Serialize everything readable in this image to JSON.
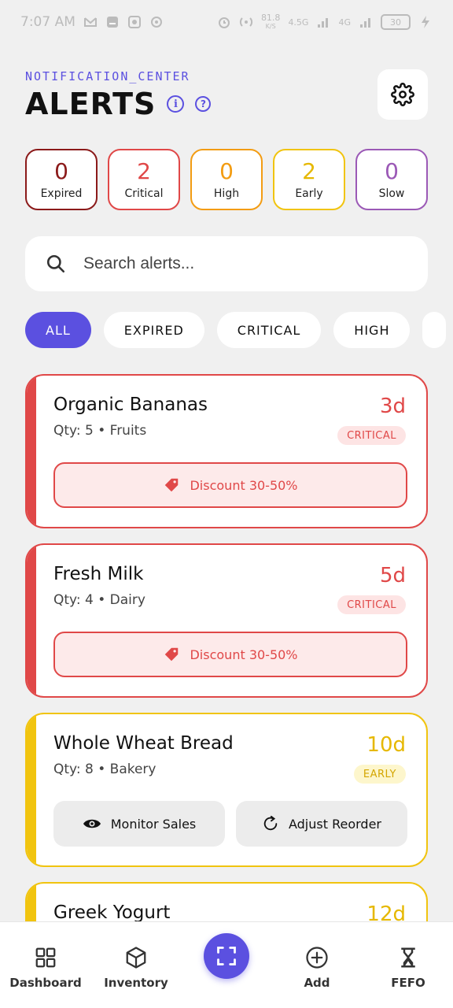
{
  "status_bar": {
    "time": "7:07 AM",
    "net_speed": "81.8",
    "net_unit": "K/S",
    "net_type": "4.5G",
    "net_type2": "4G",
    "battery": "30"
  },
  "header": {
    "subtitle": "NOTIFICATION_CENTER",
    "title": "ALERTS"
  },
  "stats": [
    {
      "value": "0",
      "label": "Expired",
      "color": "#8b1a1a"
    },
    {
      "value": "2",
      "label": "Critical",
      "color": "#e04848"
    },
    {
      "value": "0",
      "label": "High",
      "color": "#f39c12"
    },
    {
      "value": "2",
      "label": "Early",
      "color": "#f1c40f"
    },
    {
      "value": "0",
      "label": "Slow",
      "color": "#9b59b6"
    }
  ],
  "search": {
    "placeholder": "Search alerts..."
  },
  "filters": [
    "ALL",
    "EXPIRED",
    "CRITICAL",
    "HIGH"
  ],
  "alerts": [
    {
      "name": "Organic Bananas",
      "meta": "Qty: 5 • Fruits",
      "days": "3d",
      "badge": "CRITICAL",
      "action": "Discount 30-50%",
      "color": "#e04848"
    },
    {
      "name": "Fresh Milk",
      "meta": "Qty: 4 • Dairy",
      "days": "5d",
      "badge": "CRITICAL",
      "action": "Discount 30-50%",
      "color": "#e04848"
    },
    {
      "name": "Whole Wheat Bread",
      "meta": "Qty: 8 • Bakery",
      "days": "10d",
      "badge": "EARLY",
      "action1": "Monitor Sales",
      "action2": "Adjust Reorder",
      "color": "#f1c40f"
    },
    {
      "name": "Greek Yogurt",
      "days": "12d",
      "color": "#f1c40f"
    }
  ],
  "nav": {
    "dashboard": "Dashboard",
    "inventory": "Inventory",
    "add": "Add",
    "fefo": "FEFO"
  },
  "colors": {
    "accent": "#5b50e0",
    "critical": "#e04848",
    "early": "#f1c40f"
  }
}
